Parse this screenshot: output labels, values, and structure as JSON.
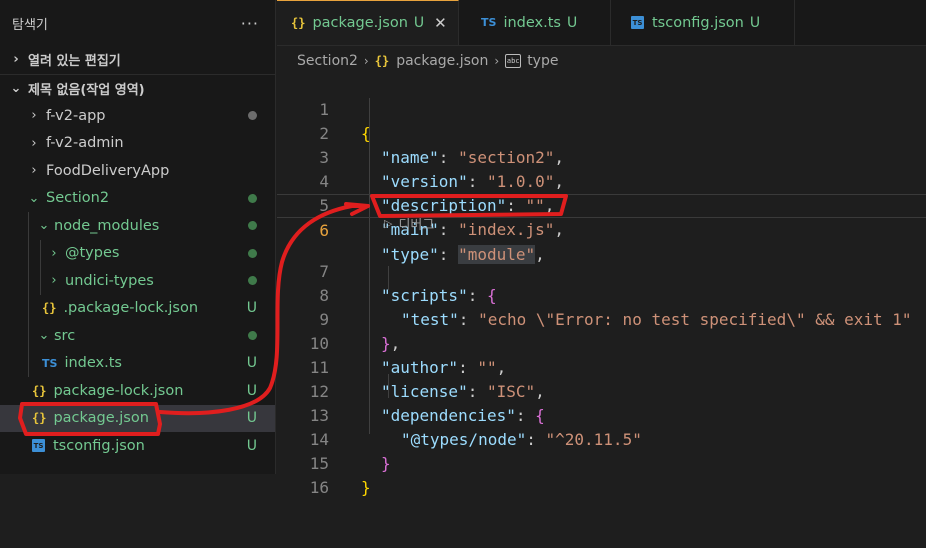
{
  "sidebar": {
    "title": "탐색기",
    "more_icon": "ellipsis-icon",
    "open_editors_label": "열려 있는 편집기",
    "workspace_label": "제목 없음(작업 영역)",
    "items": [
      {
        "label": "f-v2-app",
        "type": "folder",
        "status": "dot"
      },
      {
        "label": "f-v2-admin",
        "type": "folder",
        "status": ""
      },
      {
        "label": "FoodDeliveryApp",
        "type": "folder",
        "status": ""
      },
      {
        "label": "Section2",
        "type": "folder",
        "status": "dot"
      },
      {
        "label": "node_modules",
        "type": "folder",
        "status": "dot"
      },
      {
        "label": "@types",
        "type": "folder",
        "status": "dot"
      },
      {
        "label": "undici-types",
        "type": "folder",
        "status": "dot"
      },
      {
        "label": ".package-lock.json",
        "type": "json",
        "status": "U"
      },
      {
        "label": "src",
        "type": "folder",
        "status": "dot"
      },
      {
        "label": "index.ts",
        "type": "ts",
        "status": "U"
      },
      {
        "label": "package-lock.json",
        "type": "json",
        "status": "U"
      },
      {
        "label": "package.json",
        "type": "json",
        "status": "U"
      },
      {
        "label": "tsconfig.json",
        "type": "tsconfig",
        "status": "U"
      }
    ]
  },
  "tabs": [
    {
      "label": "package.json",
      "icon": "{}",
      "status": "U",
      "close": "✕",
      "active": true
    },
    {
      "label": "index.ts",
      "icon": "TS",
      "status": "U",
      "active": false
    },
    {
      "label": "tsconfig.json",
      "icon": "TS",
      "status": "U",
      "active": false
    }
  ],
  "breadcrumb": {
    "folder": "Section2",
    "file_icon": "{}",
    "file": "package.json",
    "symbol_icon": "abc",
    "symbol": "type"
  },
  "editor": {
    "line_numbers": [
      "1",
      "2",
      "3",
      "4",
      "5",
      "6",
      "7",
      "8",
      "9",
      "10",
      "11",
      "12",
      "13",
      "14",
      "15",
      "16"
    ],
    "current_line": "6",
    "codelens": "디버그",
    "lines": [
      [
        "{"
      ],
      [
        "\"name\"",
        ": ",
        "\"section2\"",
        ","
      ],
      [
        "\"version\"",
        ": ",
        "\"1.0.0\"",
        ","
      ],
      [
        "\"description\"",
        ": ",
        "\"\"",
        ","
      ],
      [
        "\"main\"",
        ": ",
        "\"index.js\"",
        ","
      ],
      [
        "\"type\"",
        ": ",
        "\"module\"",
        ","
      ],
      [
        "\"scripts\"",
        ": ",
        "{"
      ],
      [
        "\"test\"",
        ": ",
        "\"echo \\\"Error: no test specified\\\" && exit 1\""
      ],
      [
        "}",
        ","
      ],
      [
        "\"author\"",
        ": ",
        "\"\"",
        ","
      ],
      [
        "\"license\"",
        ": ",
        "\"ISC\"",
        ","
      ],
      [
        "\"dependencies\"",
        ": ",
        "{"
      ],
      [
        "\"@types/node\"",
        ": ",
        "\"^20.11.5\""
      ],
      [
        "}"
      ],
      [
        "}"
      ],
      [
        ""
      ]
    ]
  },
  "colors": {
    "accent_tab_border": "#e8a33d",
    "untracked_green": "#73c991",
    "annotation_red": "#e01e1e"
  }
}
